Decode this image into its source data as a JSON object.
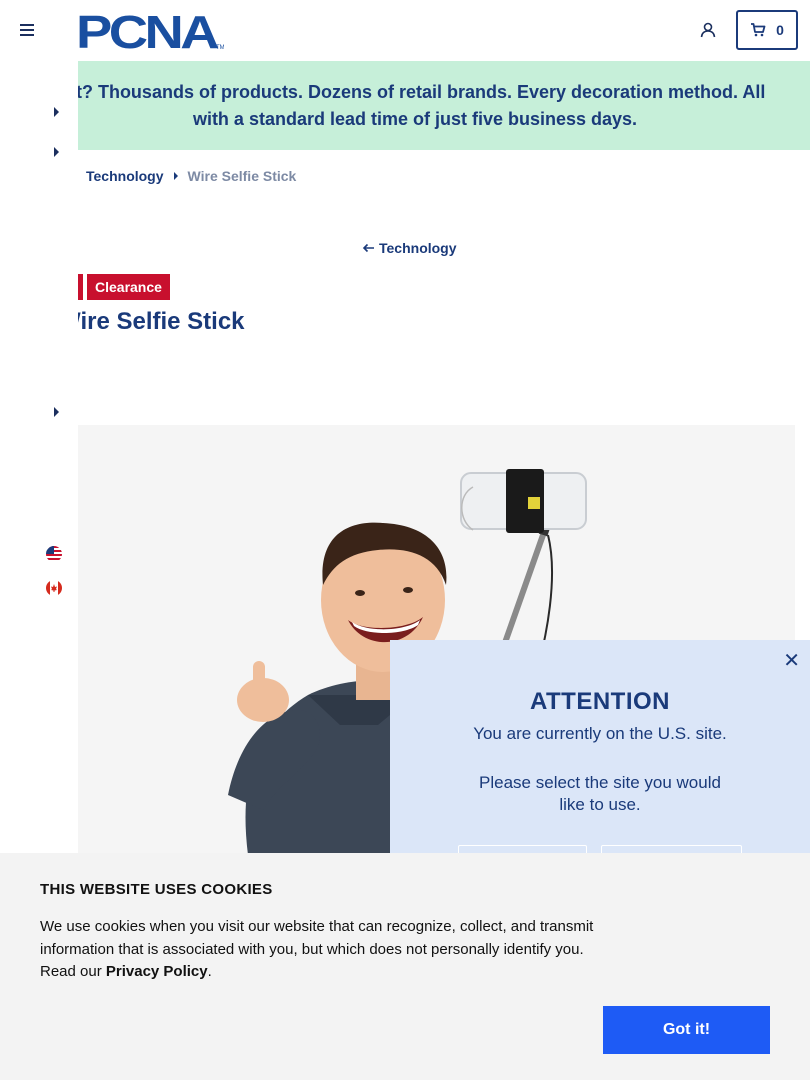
{
  "header": {
    "logo_text": "PCNA",
    "cart_count": "0"
  },
  "banner": {
    "text_line1": "Wait? Thousands of products. Dozens of retail brands. Every decoration method. All",
    "text_line2": "with a standard lead time of just five business days."
  },
  "breadcrumb": {
    "items": [
      "Technology",
      "Wire Selfie Stick"
    ]
  },
  "back_link": {
    "label": "Technology"
  },
  "product": {
    "badge": "Clearance",
    "title": "Wire Selfie Stick"
  },
  "modal": {
    "title": "ATTENTION",
    "line1": "You are currently on the U.S. site.",
    "line2": "Please select the site you would like to use."
  },
  "cookie": {
    "title": "THIS WEBSITE USES COOKIES",
    "body_before": "We use cookies when you visit our website that can recognize, collect, and transmit information that is associated with you, but which does not personally identify you. Read our ",
    "link": "Privacy Policy",
    "body_after": ".",
    "button": "Got it!"
  },
  "colors": {
    "brand_navy": "#1a3a7a",
    "banner_bg": "#c6efd9",
    "clearance_red": "#c8102e",
    "modal_bg": "#dbe6f8",
    "cookie_button": "#1e5bf5"
  },
  "icons": [
    "menu-icon",
    "user-icon",
    "cart-icon",
    "arrow-left-icon",
    "us-flag-icon",
    "canada-flag-icon",
    "close-icon"
  ]
}
